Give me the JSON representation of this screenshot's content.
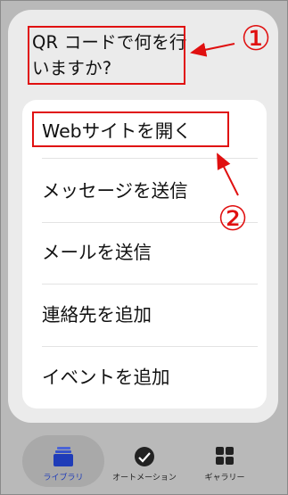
{
  "dialog": {
    "question": "QR コードで何を行いますか?"
  },
  "menu": {
    "items": [
      {
        "label": "Webサイトを開く"
      },
      {
        "label": "メッセージを送信"
      },
      {
        "label": "メールを送信"
      },
      {
        "label": "連絡先を追加"
      },
      {
        "label": "イベントを追加"
      }
    ]
  },
  "annotations": {
    "marker_1": "①",
    "marker_2": "②",
    "color": "#e01010"
  },
  "tabbar": {
    "tabs": [
      {
        "label": "ライブラリ",
        "icon": "library-icon",
        "active": true
      },
      {
        "label": "オートメーション",
        "icon": "automation-icon",
        "active": false
      },
      {
        "label": "ギャラリー",
        "icon": "gallery-icon",
        "active": false
      }
    ],
    "active_color": "#1f3cb8"
  }
}
